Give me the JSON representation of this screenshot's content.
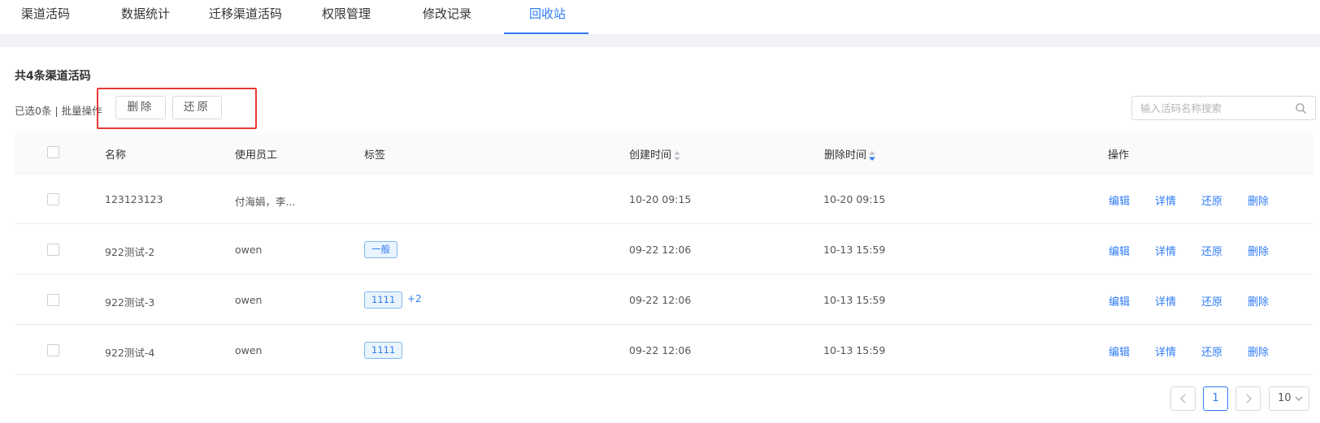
{
  "tabs": [
    {
      "label": "渠道活码"
    },
    {
      "label": "数据统计"
    },
    {
      "label": "迁移渠道活码"
    },
    {
      "label": "权限管理"
    },
    {
      "label": "修改记录"
    },
    {
      "label": "回收站",
      "active": true
    }
  ],
  "summary": {
    "count_title": "共4条渠道活码",
    "batch_text": "已选0条 | 批量操作"
  },
  "toolbar": {
    "delete_label": "删除",
    "restore_label": "还原"
  },
  "search": {
    "placeholder": "输入活码名称搜索"
  },
  "table": {
    "headers": {
      "name": "名称",
      "staff": "使用员工",
      "tags": "标签",
      "created": "创建时间",
      "deleted": "删除时间",
      "actions": "操作"
    },
    "sort": {
      "created": "none",
      "deleted": "descending"
    },
    "rows": [
      {
        "name": "123123123",
        "staff": "付海娟，李...",
        "tags": [],
        "more": "",
        "created": "10-20 09:15",
        "deleted": "10-20 09:15"
      },
      {
        "name": "922测试-2",
        "staff": "owen",
        "tags": [
          "一般"
        ],
        "more": "",
        "created": "09-22 12:06",
        "deleted": "10-13 15:59"
      },
      {
        "name": "922测试-3",
        "staff": "owen",
        "tags": [
          "1111"
        ],
        "more": "+2",
        "created": "09-22 12:06",
        "deleted": "10-13 15:59"
      },
      {
        "name": "922测试-4",
        "staff": "owen",
        "tags": [
          "1111"
        ],
        "more": "",
        "created": "09-22 12:06",
        "deleted": "10-13 15:59"
      }
    ],
    "actions": {
      "edit": "编辑",
      "detail": "详情",
      "restore": "还原",
      "delete": "删除"
    }
  },
  "pagination": {
    "current": "1",
    "page_size": "10"
  },
  "colors": {
    "accent": "#2f7cf6",
    "highlight": "#e53935",
    "tag_bg": "#eaf4fd",
    "tag_border": "#7cb8f0"
  },
  "icons": {
    "search": "search-icon",
    "sort": "sort-icon",
    "prev": "chevron-left-icon",
    "next": "chevron-right-icon",
    "dropdown": "chevron-down-icon"
  }
}
